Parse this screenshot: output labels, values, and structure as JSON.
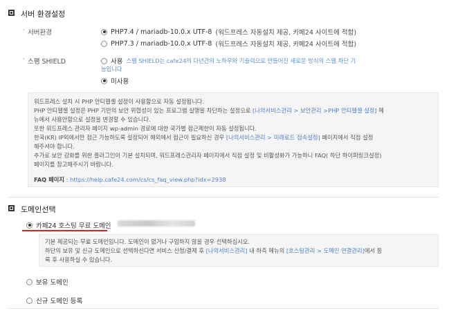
{
  "server_section": {
    "title": "서버 환경설정",
    "server_env": {
      "label": "서버환경",
      "options": [
        {
          "text": "PHP7.4 / mariadb-10.0.x UTF-8",
          "note": "(워드프레스 자동설치 제공, 카페24 사이트에 적합)",
          "selected": true
        },
        {
          "text": "PHP7.3 / mariadb-10.0.x UTF-8",
          "note": "(워드프레스 자동설치 제공, 카페24 사이트에 적합)",
          "selected": false
        }
      ]
    },
    "shield": {
      "label": "스팸 SHIELD",
      "use_label": "사용",
      "use_desc_1": "스팸 SHIELD는 cafe24의 다년간의 노하우와 기술력으로 만들어진 새로운 방식의 스팸 차단 기",
      "use_desc_2": "능입니다",
      "nouse_label": "미사용",
      "use_selected": false
    },
    "info": {
      "line1": "워드프레스 설치 시 PHP 안티웹셸 설정이 사용함으로 자동 설정됩니다.",
      "line2_a": "PHP 안티웹셸 설정은 PHP 기반의 보안 위협성이 있는 프로그램 실행을 차단하는 설정으로 ",
      "line2_link": "[나의서비스관리 > 보안관리 >PHP 안티웹셸 설정]",
      "line2_b": " 메",
      "line3": "뉴에서 사용안함으로 설정을 변경할 수 있습니다.",
      "line4": "또한 워드프레스 관리자 페이지 wp-admin 경로에 대한 국가별 접근제한이 자동 설정됩니다.",
      "line5_a": "한국(KR) IP외에서만 접근 가능하도록 설정되어 해외에서 접근이 필요하신 경우 ",
      "line5_link": "[나의서비스관리 > 미래로드 접속설정]",
      "line5_b": " 페이지에서 직접 설정",
      "line6": "해주셔야 합니다.",
      "line7": "추가로 보안 강화를 위한 플러그인이 기본 설치되며, 워드프레스관리자 페이지에서 직접 설정 및 비활성화가 가능하니 FAQ( 하단 하이퍼링크설정)",
      "line8": "페이지를 참고해주시기 바랍니다.",
      "faq_label": "FAQ 페이지",
      "faq_sep": " : ",
      "faq_url": "https://help.cafe24.com/cs/cs_faq_view.php?idx=2938"
    }
  },
  "domain_section": {
    "title": "도메인선택",
    "options": {
      "cafe24": "카페24 호스팅 무료 도메인",
      "owned": "보유 도메인",
      "new": "신규 도메인 등록"
    },
    "selected": "cafe24",
    "info": {
      "line1": "기본 제공되는 무료 도메인입니다. 도메인이 없거나 구입하지 않을 경우 선택하십시오.",
      "line2_a": "하단의 보유 및 신규 도메인으로 선택하신다면 서비스 신청/결제 후 ",
      "line2_link1": "[나의서비스관리]",
      "line2_b": " 내 하측 메뉴의 ",
      "line2_link2": "[호스팅관리 > 도메인 연결관리]",
      "line2_c": "에서 등",
      "line3": "록 후 사용하실 수 있습니다."
    }
  }
}
